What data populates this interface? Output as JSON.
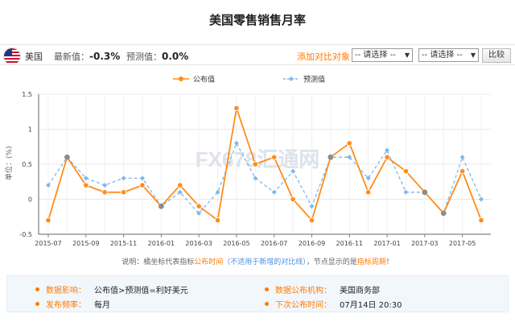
{
  "page": {
    "title": "美国零售销售月率"
  },
  "info": {
    "country": "美国",
    "latest_label": "最新值：",
    "latest_value": "-0.3%",
    "forecast_label": "预测值：",
    "forecast_value": "0.0%",
    "compare_label": "添加对比对象：",
    "select1": "-- 请选择 --",
    "select2": "-- 请选择 --",
    "compare_button": "比较"
  },
  "chart_data": {
    "type": "line",
    "title": "",
    "xlabel": "",
    "ylabel": "单位：(%)",
    "ylim": [
      -0.5,
      1.5
    ],
    "yticks": [
      "1.5",
      "1",
      "0.5",
      "0",
      "-0.5"
    ],
    "xtick_labels": [
      "2015-07",
      "2015-09",
      "2015-11",
      "2016-01",
      "2016-03",
      "2016-05",
      "2016-07",
      "2016-09",
      "2016-11",
      "2017-01",
      "2017-03",
      "2017-05"
    ],
    "x": [
      "2015-07",
      "2015-08",
      "2015-09",
      "2015-10",
      "2015-11",
      "2015-12",
      "2016-01",
      "2016-02",
      "2016-03",
      "2016-04",
      "2016-05",
      "2016-06",
      "2016-07",
      "2016-08",
      "2016-09",
      "2016-10",
      "2016-11",
      "2016-12",
      "2017-01",
      "2017-02",
      "2017-03",
      "2017-04",
      "2017-05",
      "2017-06"
    ],
    "series": [
      {
        "name": "公布值",
        "color": "#ff8c1a",
        "style": "solid",
        "values": [
          -0.3,
          0.6,
          0.2,
          0.1,
          0.1,
          0.2,
          -0.1,
          0.2,
          -0.1,
          -0.3,
          1.3,
          0.5,
          0.6,
          0.0,
          -0.3,
          0.6,
          0.8,
          0.1,
          0.6,
          0.4,
          0.1,
          -0.2,
          0.4,
          -0.3
        ]
      },
      {
        "name": "预测值",
        "color": "#7fb8ec",
        "style": "dashed",
        "values": [
          0.2,
          0.6,
          0.3,
          0.2,
          0.3,
          0.3,
          -0.1,
          0.1,
          -0.2,
          0.1,
          0.8,
          0.3,
          0.1,
          0.4,
          -0.1,
          0.6,
          0.6,
          0.3,
          0.7,
          0.1,
          0.1,
          -0.2,
          0.6,
          0.0
        ]
      }
    ],
    "legend": "top-center",
    "grid": true
  },
  "note": {
    "p1": "说明：橘坐标代表指标",
    "p2": "公布时间",
    "p3": "（不适用于新增的对比线）",
    "p4": "，节点显示的是",
    "p5": "指标周期",
    "p6": "！"
  },
  "bottom": {
    "impact_label": "数据影响：",
    "impact_value": "公布值>预测值=利好美元",
    "freq_label": "发布频率：",
    "freq_value": "每月",
    "agency_label": "数据公布机构：",
    "agency_value": "美国商务部",
    "next_label": "下次公布时间：",
    "next_value": "07月14日 20:30"
  },
  "watermark": "FX678汇通网",
  "colors": {
    "accent": "#ff7a00",
    "forecast": "#7fb8ec",
    "actual": "#ff8c1a"
  },
  "icons": {
    "flag": "us-flag-icon"
  }
}
